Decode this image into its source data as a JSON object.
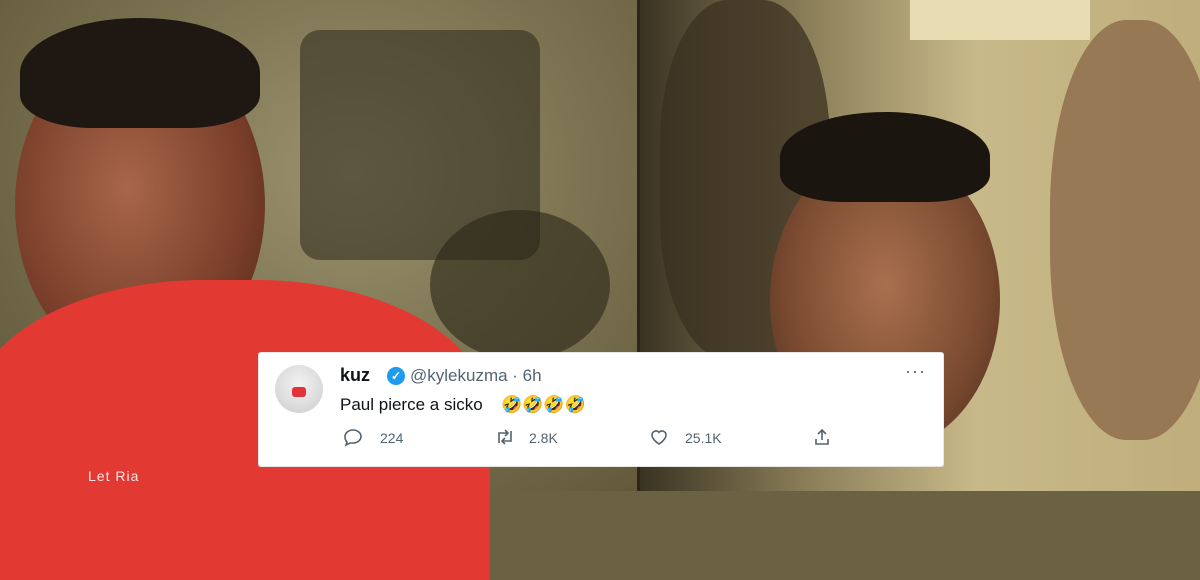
{
  "tweet": {
    "display_name": "kuz",
    "handle_time": "@kylekuzma · 6h",
    "text": "Paul pierce a sicko",
    "emojis": "🤣🤣🤣🤣",
    "more_label": "···",
    "reply_count": "224",
    "retweet_count": "2.8K",
    "like_count": "25.1K",
    "icons": [
      "reply-icon",
      "retweet-icon",
      "like-icon",
      "share-icon"
    ]
  },
  "colors": {
    "verified": "#1d9bf0",
    "jersey_red": "#e23a33",
    "sepia": "#b9a97a"
  },
  "background_caption": "Let Ria"
}
